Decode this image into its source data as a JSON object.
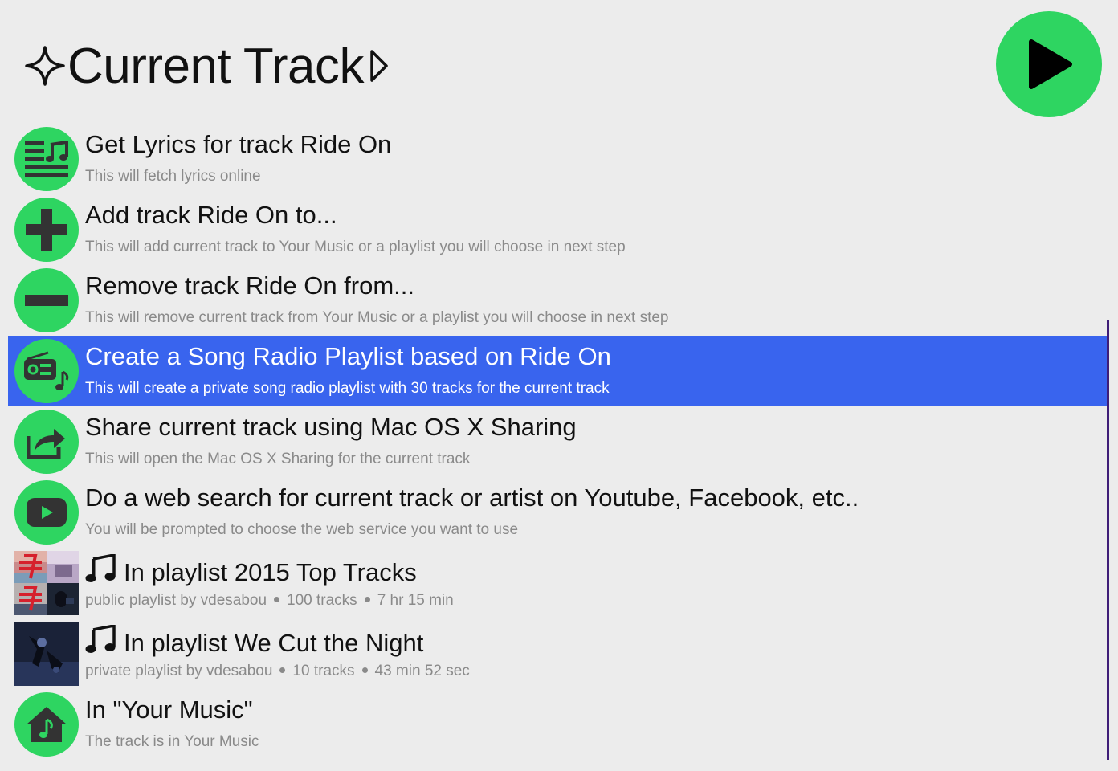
{
  "header": {
    "title": "Current Track",
    "sparkle_icon": "sparkle-icon",
    "disclosure_icon": "triangle-right-icon"
  },
  "play_button": {
    "icon": "play-icon"
  },
  "colors": {
    "accent_green": "#2ed561",
    "selection_blue": "#3964ee",
    "icon_dark": "#333333",
    "scrollbar": "#3f1d78"
  },
  "items": [
    {
      "icon": "lyrics-icon",
      "title": "Get Lyrics for track Ride On",
      "subtitle": "This will fetch lyrics online"
    },
    {
      "icon": "plus-icon",
      "title": "Add track Ride On to...",
      "subtitle": "This will add current track to Your Music or a playlist you will choose in next step"
    },
    {
      "icon": "minus-icon",
      "title": "Remove track Ride On from...",
      "subtitle": "This will remove current track from Your Music or a playlist you will choose in next step"
    },
    {
      "icon": "radio-icon",
      "title": "Create a Song Radio Playlist based on Ride On",
      "subtitle": "This will create a private song radio playlist with 30 tracks for the current track",
      "selected": true
    },
    {
      "icon": "share-icon",
      "title": "Share current track using Mac OS X Sharing",
      "subtitle": "This will open the Mac OS X Sharing for the current track"
    },
    {
      "icon": "youtube-icon",
      "title": "Do a web search for current track or artist on Youtube, Facebook, etc..",
      "subtitle": "You will be prompted to choose the web service you want to use"
    },
    {
      "icon": "music-note-icon",
      "title": "In playlist 2015 Top Tracks",
      "meta": [
        "public playlist by vdesabou",
        "100 tracks",
        "7 hr 15 min"
      ]
    },
    {
      "icon": "music-note-icon",
      "title": "In playlist We Cut the Night",
      "meta": [
        "private playlist by vdesabou",
        "10 tracks",
        "43 min 52 sec"
      ]
    },
    {
      "icon": "home-music-icon",
      "title": "In \"Your Music\"",
      "subtitle": "The track is in Your Music"
    }
  ]
}
